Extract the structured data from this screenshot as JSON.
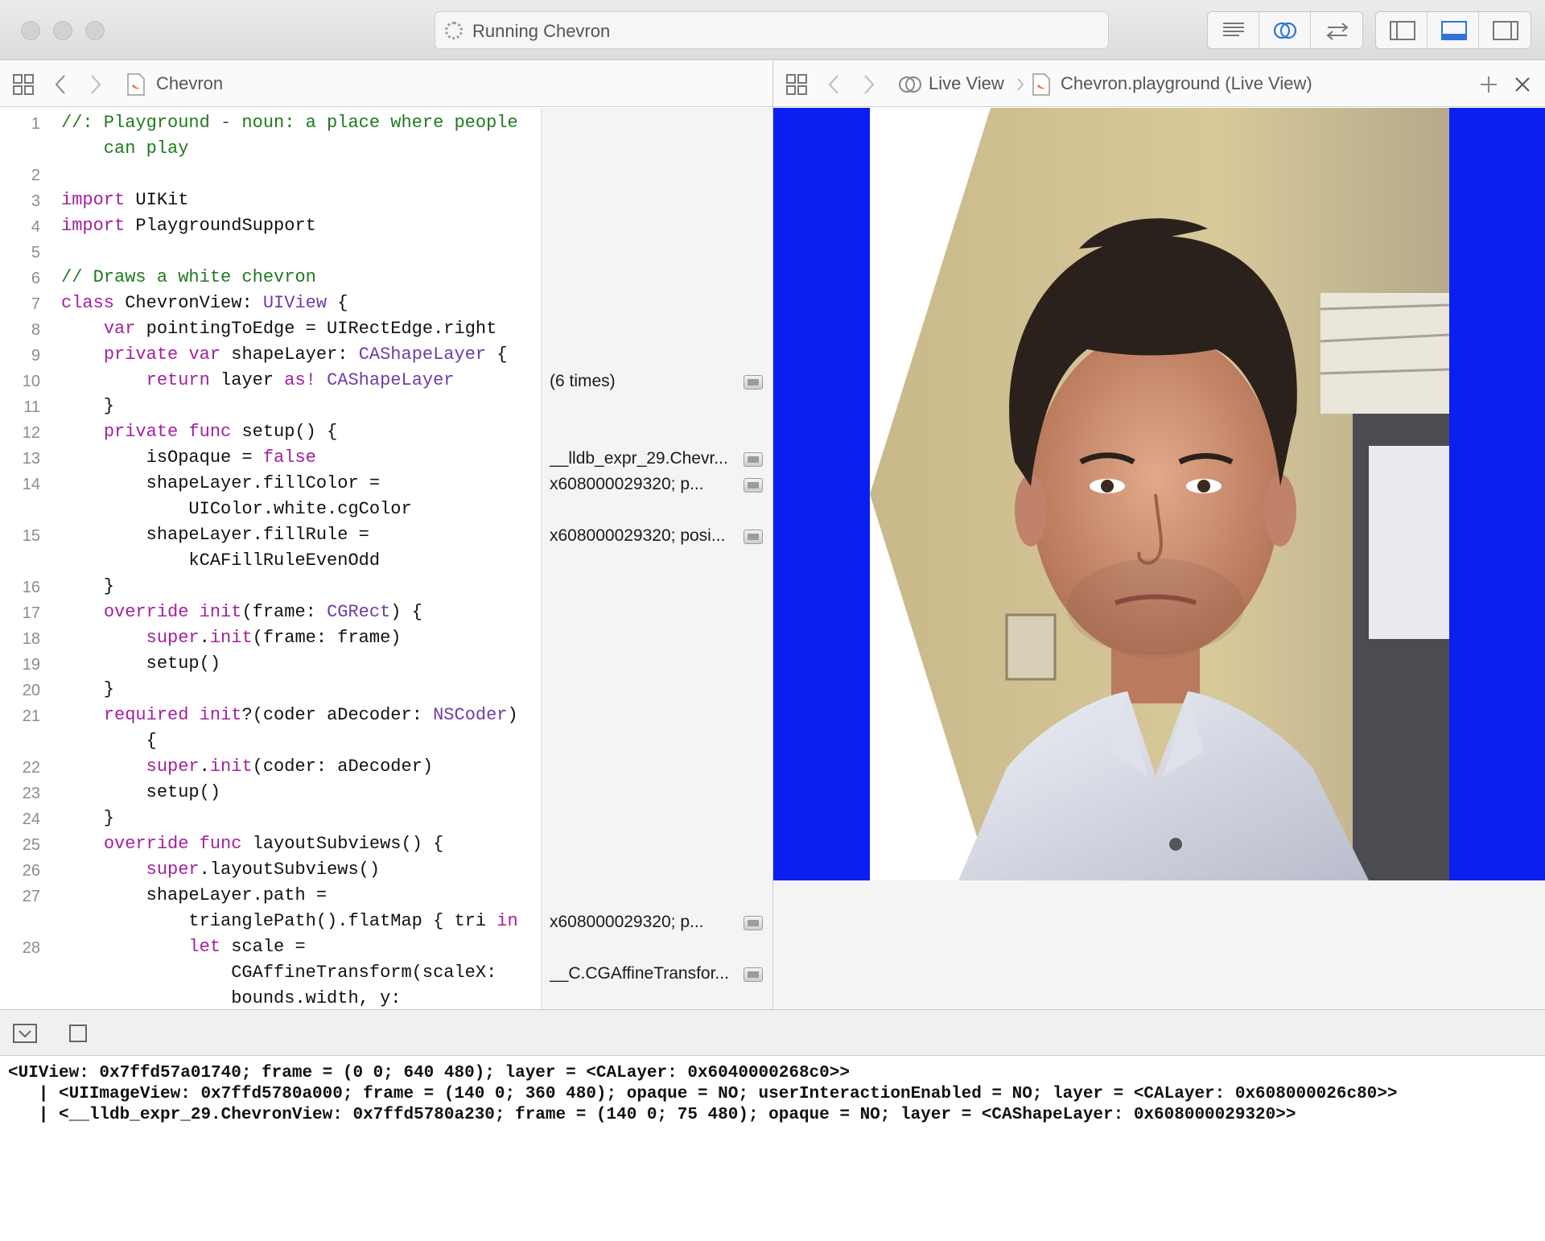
{
  "window": {
    "activity_text": "Running Chevron"
  },
  "editor_jumpbar": {
    "file_name": "Chevron"
  },
  "liveview_jumpbar": {
    "crumb_1": "Live View",
    "crumb_2": "Chevron.playground (Live View)"
  },
  "code": [
    {
      "n": "1",
      "t": "//: Playground - noun: a place where people",
      "cls": "cm"
    },
    {
      "n": "",
      "t": "    can play",
      "cls": "cm"
    },
    {
      "n": "2",
      "t": ""
    },
    {
      "n": "3",
      "t": "import UIKit"
    },
    {
      "n": "4",
      "t": "import PlaygroundSupport"
    },
    {
      "n": "5",
      "t": ""
    },
    {
      "n": "6",
      "t": "// Draws a white chevron",
      "cls": "cm"
    },
    {
      "n": "7",
      "t": "class ChevronView: UIView {"
    },
    {
      "n": "8",
      "t": "    var pointingToEdge = UIRectEdge.right"
    },
    {
      "n": "9",
      "t": "    private var shapeLayer: CAShapeLayer {"
    },
    {
      "n": "10",
      "t": "        return layer as! CAShapeLayer"
    },
    {
      "n": "11",
      "t": "    }"
    },
    {
      "n": "12",
      "t": "    private func setup() {"
    },
    {
      "n": "13",
      "t": "        isOpaque = false"
    },
    {
      "n": "14",
      "t": "        shapeLayer.fillColor ="
    },
    {
      "n": "",
      "t": "            UIColor.white.cgColor"
    },
    {
      "n": "15",
      "t": "        shapeLayer.fillRule ="
    },
    {
      "n": "",
      "t": "            kCAFillRuleEvenOdd"
    },
    {
      "n": "16",
      "t": "    }"
    },
    {
      "n": "17",
      "t": "    override init(frame: CGRect) {"
    },
    {
      "n": "18",
      "t": "        super.init(frame: frame)"
    },
    {
      "n": "19",
      "t": "        setup()"
    },
    {
      "n": "20",
      "t": "    }"
    },
    {
      "n": "21",
      "t": "    required init?(coder aDecoder: NSCoder)"
    },
    {
      "n": "",
      "t": "        {"
    },
    {
      "n": "22",
      "t": "        super.init(coder: aDecoder)"
    },
    {
      "n": "23",
      "t": "        setup()"
    },
    {
      "n": "24",
      "t": "    }"
    },
    {
      "n": "25",
      "t": "    override func layoutSubviews() {"
    },
    {
      "n": "26",
      "t": "        super.layoutSubviews()"
    },
    {
      "n": "27",
      "t": "        shapeLayer.path ="
    },
    {
      "n": "",
      "t": "            trianglePath().flatMap { tri in"
    },
    {
      "n": "28",
      "t": "            let scale ="
    },
    {
      "n": "",
      "t": "                CGAffineTransform(scaleX:"
    },
    {
      "n": "",
      "t": "                bounds.width, y:"
    }
  ],
  "results": [
    {
      "row": 10,
      "text": "(6 times)"
    },
    {
      "row": 13,
      "text": "__lldb_expr_29.Chevr..."
    },
    {
      "row": 14,
      "text": "x608000029320; p..."
    },
    {
      "row": 16,
      "text": "x608000029320; posi..."
    },
    {
      "row": 31,
      "text": "x608000029320; p..."
    },
    {
      "row": 33,
      "text": "__C.CGAffineTransfor..."
    }
  ],
  "console": [
    "<UIView: 0x7ffd57a01740; frame = (0 0; 640 480); layer = <CALayer: 0x6040000268c0>>",
    "   | <UIImageView: 0x7ffd5780a000; frame = (140 0; 360 480); opaque = NO; userInteractionEnabled = NO; layer = <CALayer: 0x608000026c80>>",
    "   | <__lldb_expr_29.ChevronView: 0x7ffd5780a230; frame = (140 0; 75 480); opaque = NO; layer = <CAShapeLayer: 0x608000029320>>"
  ],
  "colors": {
    "liveview_background": "#0a1ff0",
    "keyword": "#a3219d",
    "type": "#6f3ba8",
    "comment": "#1f7a1f"
  },
  "icons": {
    "close_window": "traffic-light-close-icon",
    "minimize_window": "traffic-light-minimize-icon",
    "zoom_window": "traffic-light-zoom-icon",
    "activity_spinner": "spinner-icon",
    "standard_editor": "standard-editor-icon",
    "assistant_editor": "assistant-editor-icon",
    "version_editor": "version-editor-icon",
    "navigator_toggle": "navigator-panel-icon",
    "debug_toggle": "debug-panel-icon",
    "inspector_toggle": "inspector-panel-icon"
  }
}
